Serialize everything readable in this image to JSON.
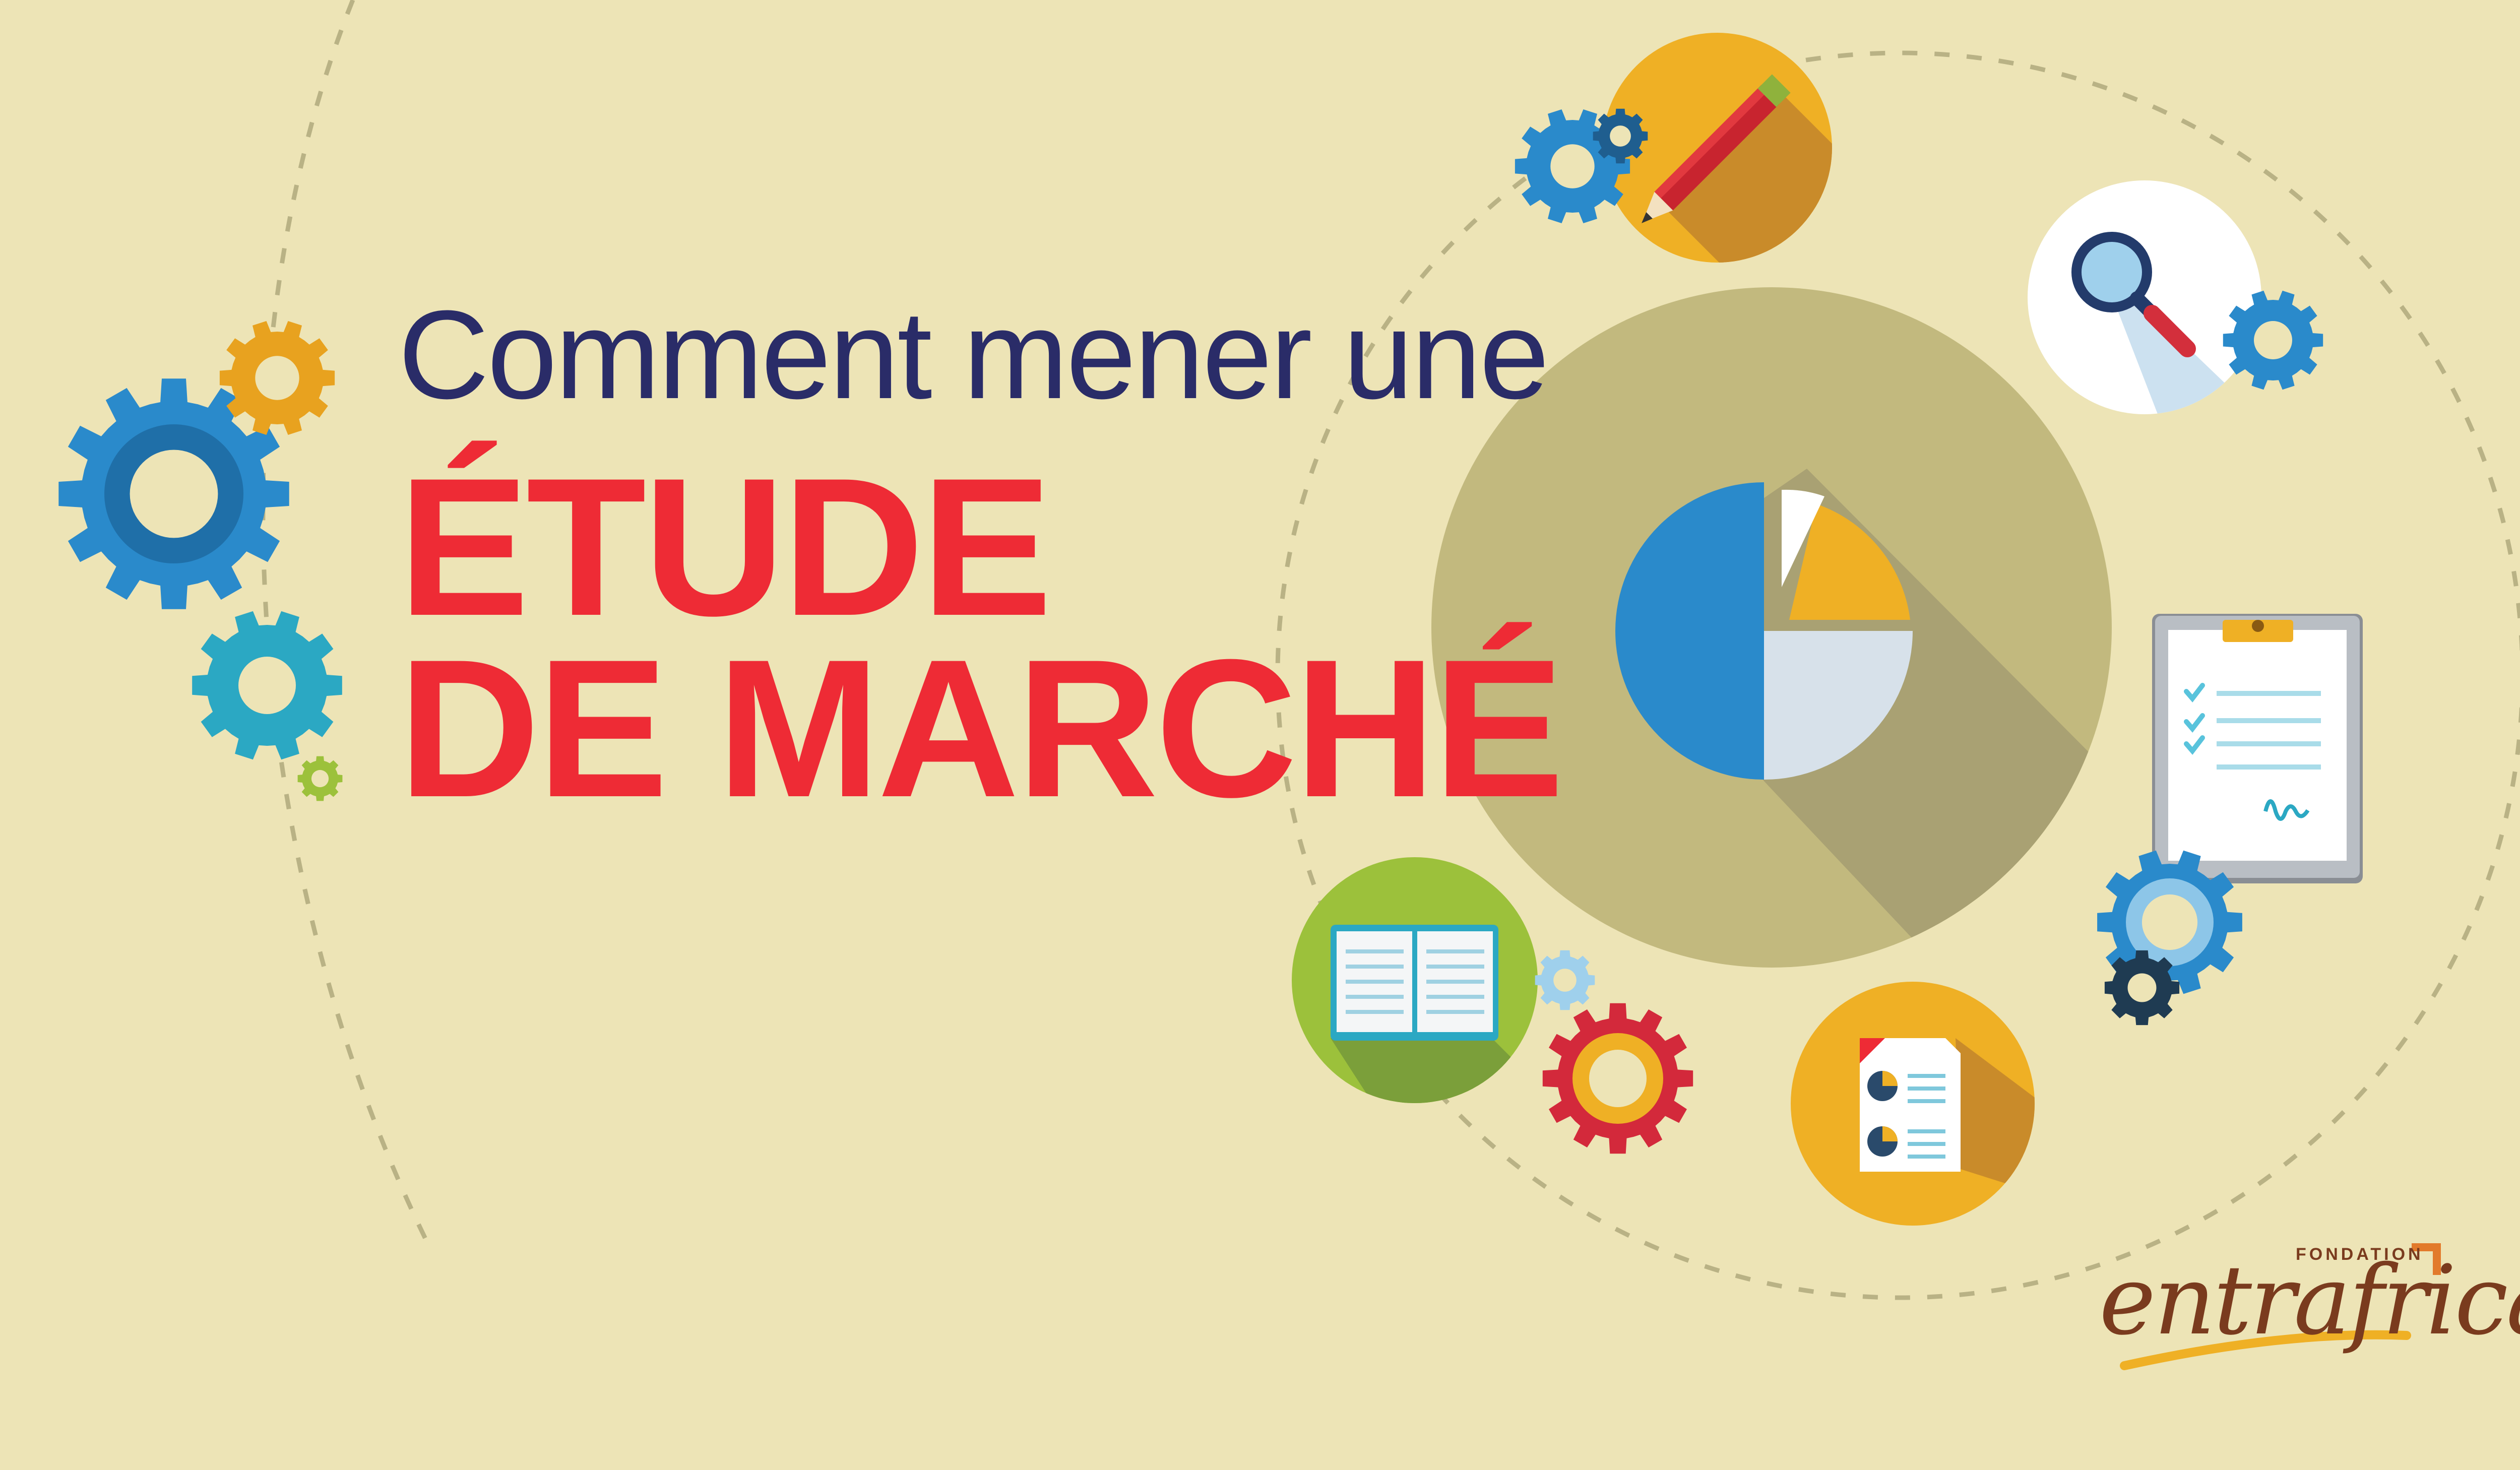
{
  "headline": {
    "line1": "Comment mener une",
    "line2": "ÉTUDE",
    "line3": "DE MARCHÉ"
  },
  "brand": {
    "kicker": "FONDATION",
    "name": "entrafrica"
  },
  "icons": [
    "gear-icon",
    "pencil-icon",
    "magnifier-icon",
    "pie-chart-icon",
    "clipboard-icon",
    "open-book-icon",
    "report-document-icon"
  ],
  "colors": {
    "background": "#EDE4B6",
    "headline_navy": "#2A2C68",
    "headline_red": "#EE2B35",
    "circle_olive": "#C2B97E",
    "orange": "#EFB025",
    "blue": "#2A8ACB",
    "teal": "#2BA8C3",
    "green": "#9CC13B",
    "brand_brown": "#7A3B1E"
  }
}
